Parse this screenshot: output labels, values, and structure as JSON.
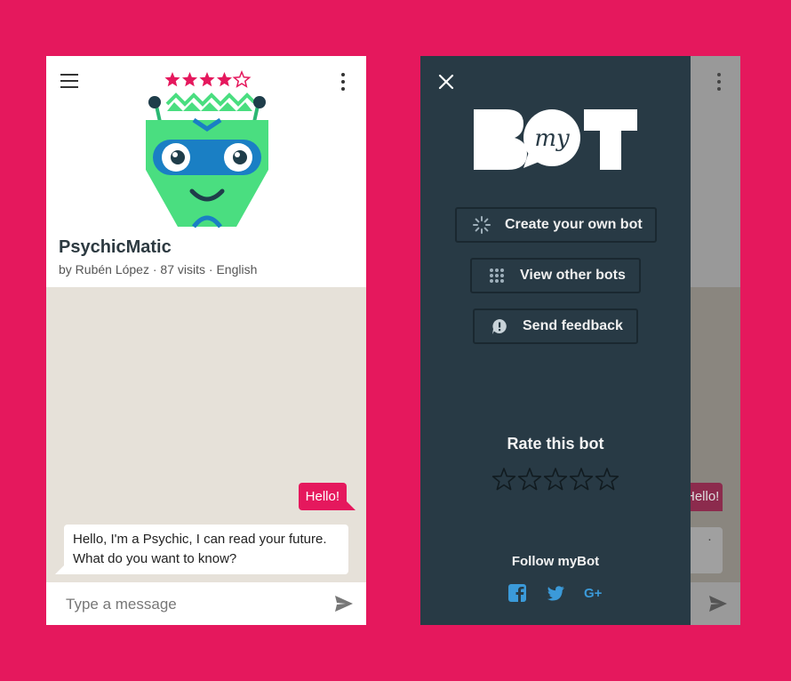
{
  "colors": {
    "background": "#e5185d",
    "accent": "#e5185d",
    "drawer": "#283a45",
    "chat_bg": "#e6e1d9",
    "robot_green": "#4ade80",
    "robot_blue": "#1a7fc4",
    "social_blue": "#3b9ad9"
  },
  "bot": {
    "name": "PsychicMatic",
    "author": "by Rubén López",
    "visits": "87 visits",
    "language": "English",
    "separator": " · ",
    "rating": 4,
    "rating_max": 5
  },
  "chat": {
    "messages": [
      {
        "from": "user",
        "text": "Hello!"
      },
      {
        "from": "bot",
        "text": "Hello, I'm a Psychic, I can read your future. What do you want to know?"
      }
    ],
    "input_placeholder": "Type a message"
  },
  "drawer": {
    "logo_text": "my",
    "buttons": [
      {
        "label": "Create your own bot",
        "icon": "spinner-icon"
      },
      {
        "label": "View other bots",
        "icon": "grid-icon"
      },
      {
        "label": "Send feedback",
        "icon": "feedback-icon"
      }
    ],
    "rate_title": "Rate this bot",
    "rate_value": 0,
    "follow_title": "Follow myBot",
    "social": [
      "facebook-icon",
      "twitter-icon",
      "google-plus-icon"
    ]
  },
  "ghost": {
    "user_text": "Hello!",
    "bot_text": "."
  }
}
